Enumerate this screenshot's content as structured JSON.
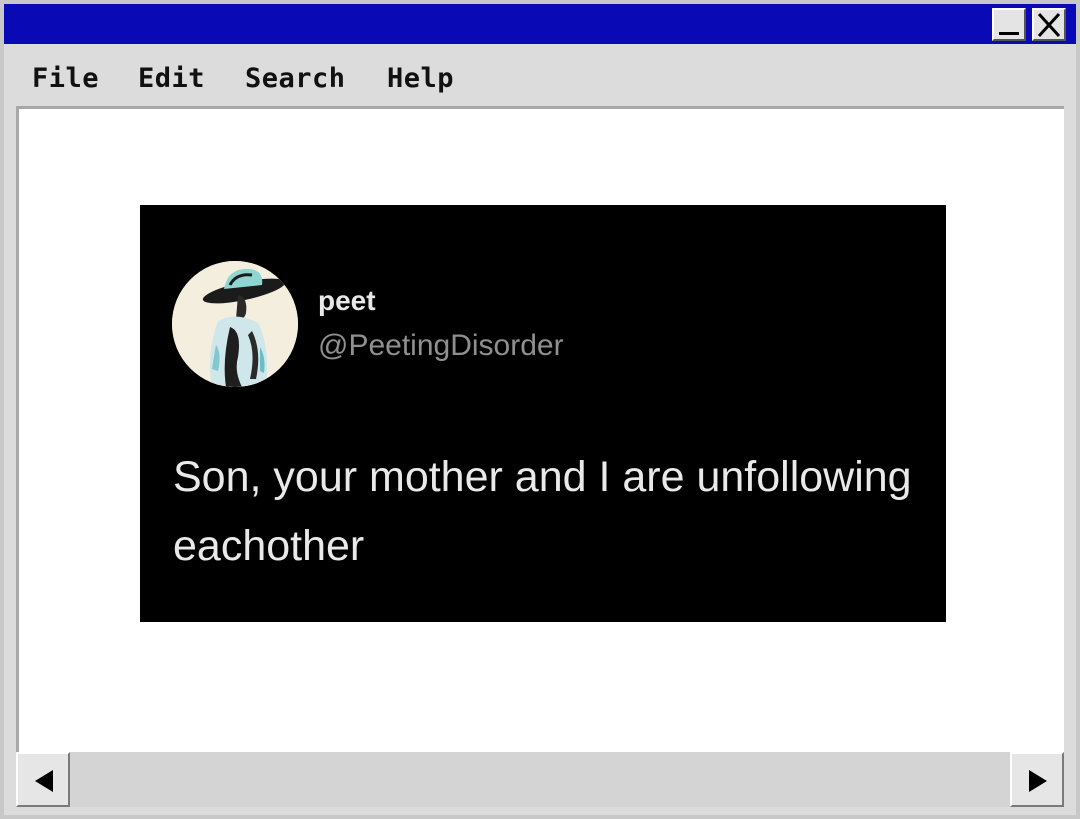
{
  "window": {
    "controls": {
      "minimize_icon": "minimize-icon",
      "close_icon": "close-icon"
    },
    "title_bar_color": "#0a09b6"
  },
  "menu": {
    "items": [
      {
        "label": "File"
      },
      {
        "label": "Edit"
      },
      {
        "label": "Search"
      },
      {
        "label": "Help"
      }
    ]
  },
  "tweet": {
    "display_name": "peet",
    "handle": "@PeetingDisorder",
    "text": "Son, your mother and I are unfollowing eachother",
    "background": "#000000"
  },
  "scrollbar": {
    "left_icon": "arrow-left-icon",
    "right_icon": "arrow-right-icon"
  }
}
